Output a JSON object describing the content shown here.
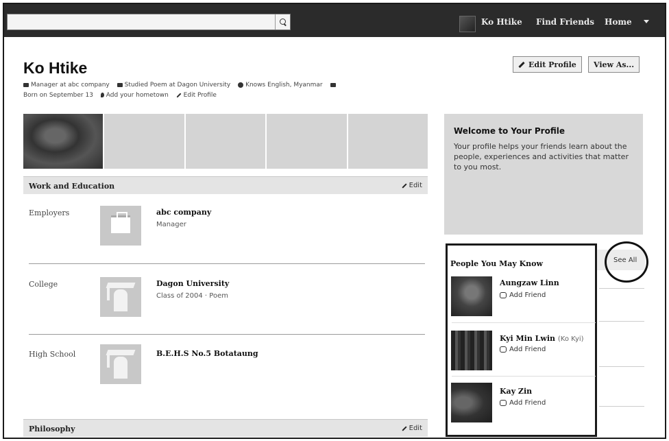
{
  "topbar": {
    "search_placeholder": "",
    "nav": {
      "profile_name": "Ko Htike",
      "find_friends": "Find Friends",
      "home": "Home"
    }
  },
  "profile": {
    "name": "Ko Htike",
    "edit_profile_button": "Edit Profile",
    "view_as_button": "View As...",
    "info": {
      "work": "Manager at abc company",
      "studied": "Studied Poem at Dagon University",
      "languages": "Knows English, Myanmar",
      "born": "Born on September 13",
      "hometown": "Add your hometown",
      "edit": "Edit Profile"
    }
  },
  "work_education": {
    "title": "Work and Education",
    "edit_label": "Edit",
    "rows": [
      {
        "label": "Employers",
        "title": "abc company",
        "subtitle": "Manager"
      },
      {
        "label": "College",
        "title": "Dagon University",
        "subtitle": "Class of 2004 · Poem"
      },
      {
        "label": "High School",
        "title": "B.E.H.S No.5 Botataung",
        "subtitle": ""
      }
    ]
  },
  "philosophy": {
    "title": "Philosophy",
    "edit_label": "Edit"
  },
  "welcome": {
    "title": "Welcome to Your Profile",
    "body": "Your profile helps your friends learn about the people, experiences and activities that matter to you most."
  },
  "people_you_may_know": {
    "title": "People You May Know",
    "see_all": "See All",
    "people": [
      {
        "name": "Aungzaw Linn",
        "nickname": "",
        "action": "Add Friend"
      },
      {
        "name": "Kyi Min Lwin",
        "nickname": "(Ko Kyi)",
        "action": "Add Friend"
      },
      {
        "name": "Kay Zin",
        "nickname": "",
        "action": "Add Friend"
      }
    ]
  },
  "icons": {
    "search": "search-icon",
    "work": "briefcase-icon",
    "education": "graduation-cap-icon",
    "language": "globe-icon",
    "birthday": "calendar-icon",
    "hometown": "location-pin-icon",
    "edit": "pencil-icon",
    "add_friend": "add-friend-icon"
  }
}
